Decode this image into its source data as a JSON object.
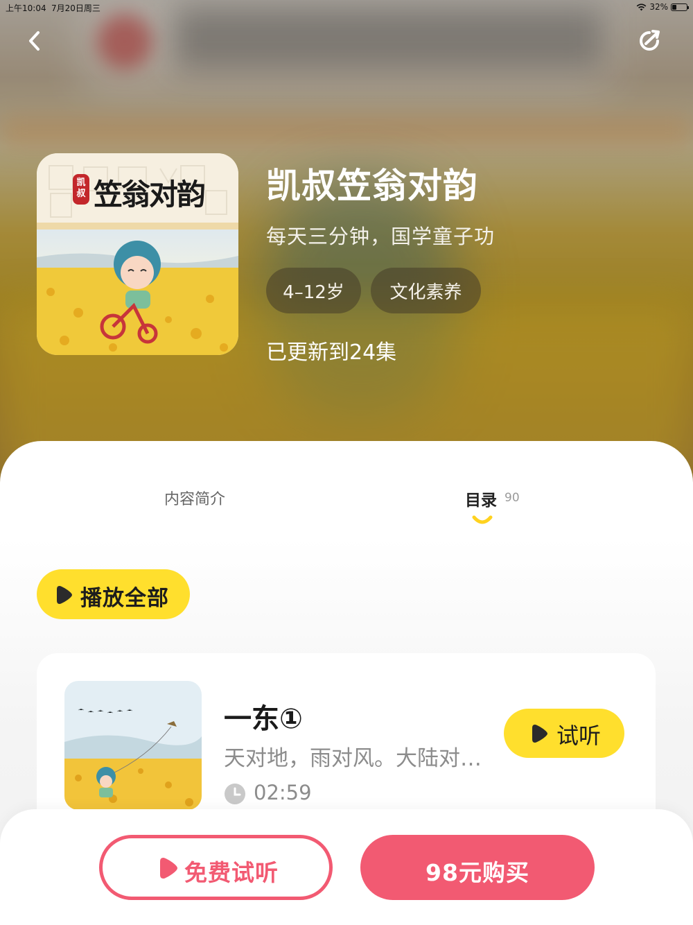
{
  "status_bar": {
    "time": "上午10:04",
    "date": "7月20日周三",
    "battery": "32%",
    "battery_level": 0.32
  },
  "nav": {
    "back_icon": "chevron-left-icon",
    "share_icon": "share-arrow-icon"
  },
  "book": {
    "cover_seal": "凯叔",
    "cover_title": "笠翁对韵",
    "title": "凯叔笠翁对韵",
    "subtitle": "每天三分钟，国学童子功",
    "tags": [
      "4–12岁",
      "文化素养"
    ],
    "update_status": "已更新到24集"
  },
  "tabs": {
    "intro_label": "内容简介",
    "catalog_label": "目录",
    "catalog_count": "90",
    "active": "catalog"
  },
  "play_all_label": "播放全部",
  "episodes": [
    {
      "title": "一东①",
      "description": "天对地，雨对风。大陆对长空。",
      "duration": "02:59",
      "preview_label": "试听"
    }
  ],
  "bottom": {
    "free_trial_label": "免费试听",
    "buy_label": "98元购买"
  },
  "colors": {
    "accent_yellow": "#ffdf2d",
    "accent_pink": "#f25a72",
    "text_dark": "#1a1a1a",
    "text_muted": "#8c8c8c"
  }
}
